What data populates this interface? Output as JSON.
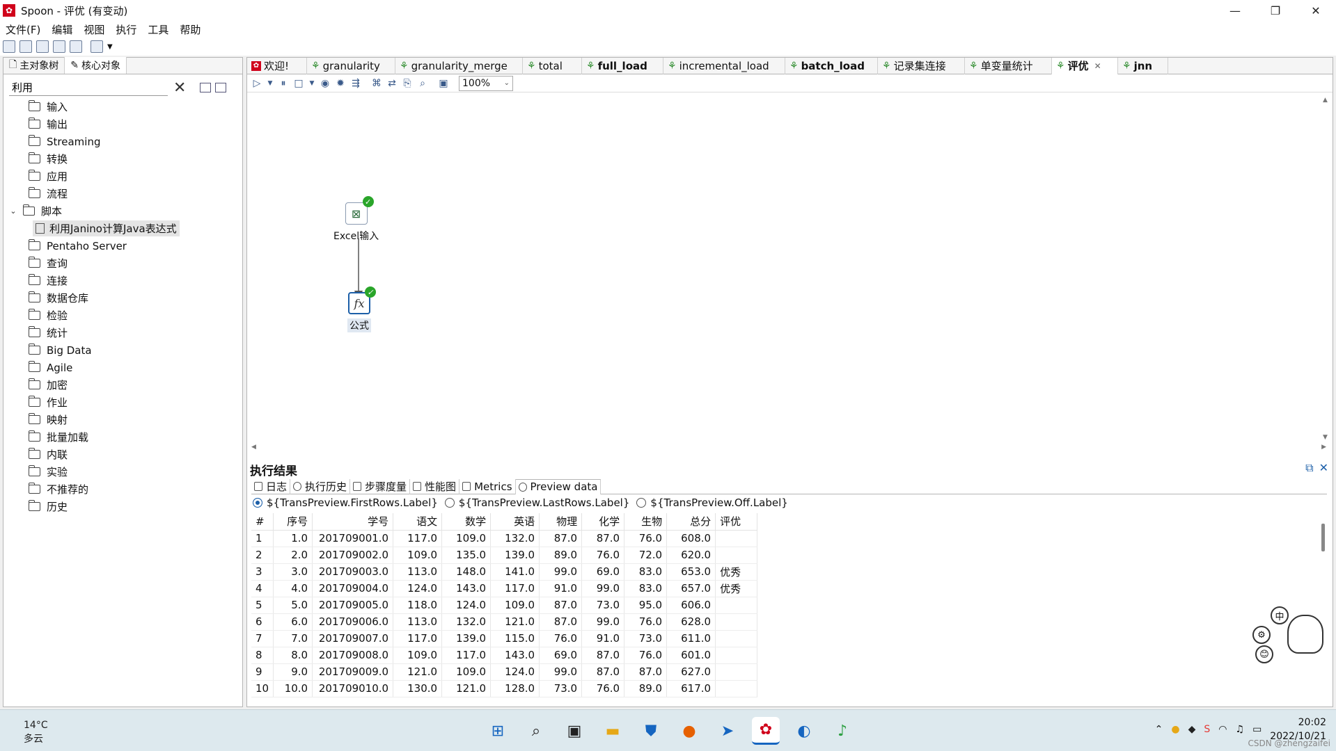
{
  "window": {
    "title": "Spoon - 评优 (有变动)",
    "app_icon": "spoon-icon",
    "controls": [
      "—",
      "❐",
      "✕"
    ]
  },
  "menu": [
    "文件(F)",
    "编辑",
    "视图",
    "执行",
    "工具",
    "帮助"
  ],
  "left_panel": {
    "tabs": [
      "主对象树",
      "核心对象"
    ],
    "search_value": "利用",
    "tree": [
      {
        "label": "输入",
        "expanded": false
      },
      {
        "label": "输出",
        "expanded": false
      },
      {
        "label": "Streaming",
        "expanded": false
      },
      {
        "label": "转换",
        "expanded": false
      },
      {
        "label": "应用",
        "expanded": false
      },
      {
        "label": "流程",
        "expanded": false
      },
      {
        "label": "脚本",
        "expanded": true
      },
      {
        "label": "利用Janino计算Java表达式",
        "child": true
      },
      {
        "label": "Pentaho Server"
      },
      {
        "label": "查询"
      },
      {
        "label": "连接"
      },
      {
        "label": "数据仓库"
      },
      {
        "label": "检验"
      },
      {
        "label": "统计"
      },
      {
        "label": "Big Data"
      },
      {
        "label": "Agile"
      },
      {
        "label": "加密"
      },
      {
        "label": "作业"
      },
      {
        "label": "映射"
      },
      {
        "label": "批量加载"
      },
      {
        "label": "内联"
      },
      {
        "label": "实验"
      },
      {
        "label": "不推荐的"
      },
      {
        "label": "历史"
      }
    ]
  },
  "editor_tabs": [
    {
      "label": "欢迎!",
      "icon": "welcome-icon",
      "bold": false
    },
    {
      "label": "granularity",
      "icon": "transformation-icon",
      "bold": false
    },
    {
      "label": "granularity_merge",
      "icon": "transformation-icon",
      "bold": false
    },
    {
      "label": "total",
      "icon": "transformation-icon",
      "bold": false
    },
    {
      "label": "full_load",
      "icon": "transformation-icon",
      "bold": true
    },
    {
      "label": "incremental_load",
      "icon": "transformation-icon",
      "bold": false
    },
    {
      "label": "batch_load",
      "icon": "transformation-icon",
      "bold": true
    },
    {
      "label": "记录集连接",
      "icon": "transformation-icon",
      "bold": false
    },
    {
      "label": "单变量统计",
      "icon": "transformation-icon",
      "bold": false
    },
    {
      "label": "评优",
      "icon": "transformation-icon",
      "bold": true,
      "active": true
    },
    {
      "label": "jnn",
      "icon": "transformation-icon",
      "bold": true
    }
  ],
  "zoom": "100%",
  "steps": {
    "excel": {
      "label": "Excel输入",
      "icon": "excel-icon"
    },
    "formula": {
      "label": "公式",
      "icon": "formula-icon",
      "glyph": "fx"
    }
  },
  "results": {
    "title": "执行结果",
    "tabs": [
      "日志",
      "执行历史",
      "步骤度量",
      "性能图",
      "Metrics",
      "Preview data"
    ],
    "radios": [
      "${TransPreview.FirstRows.Label}",
      "${TransPreview.LastRows.Label}",
      "${TransPreview.Off.Label}"
    ],
    "columns": [
      "#",
      "序号",
      "学号",
      "语文",
      "数学",
      "英语",
      "物理",
      "化学",
      "生物",
      "总分",
      "评优"
    ],
    "rows": [
      [
        "1",
        "1.0",
        "201709001.0",
        "117.0",
        "109.0",
        "132.0",
        "87.0",
        "87.0",
        "76.0",
        "608.0",
        ""
      ],
      [
        "2",
        "2.0",
        "201709002.0",
        "109.0",
        "135.0",
        "139.0",
        "89.0",
        "76.0",
        "72.0",
        "620.0",
        ""
      ],
      [
        "3",
        "3.0",
        "201709003.0",
        "113.0",
        "148.0",
        "141.0",
        "99.0",
        "69.0",
        "83.0",
        "653.0",
        "优秀"
      ],
      [
        "4",
        "4.0",
        "201709004.0",
        "124.0",
        "143.0",
        "117.0",
        "91.0",
        "99.0",
        "83.0",
        "657.0",
        "优秀"
      ],
      [
        "5",
        "5.0",
        "201709005.0",
        "118.0",
        "124.0",
        "109.0",
        "87.0",
        "73.0",
        "95.0",
        "606.0",
        ""
      ],
      [
        "6",
        "6.0",
        "201709006.0",
        "113.0",
        "132.0",
        "121.0",
        "87.0",
        "99.0",
        "76.0",
        "628.0",
        ""
      ],
      [
        "7",
        "7.0",
        "201709007.0",
        "117.0",
        "139.0",
        "115.0",
        "76.0",
        "91.0",
        "73.0",
        "611.0",
        ""
      ],
      [
        "8",
        "8.0",
        "201709008.0",
        "109.0",
        "117.0",
        "143.0",
        "69.0",
        "87.0",
        "76.0",
        "601.0",
        ""
      ],
      [
        "9",
        "9.0",
        "201709009.0",
        "121.0",
        "109.0",
        "124.0",
        "99.0",
        "87.0",
        "87.0",
        "627.0",
        ""
      ],
      [
        "10",
        "10.0",
        "201709010.0",
        "130.0",
        "121.0",
        "128.0",
        "73.0",
        "76.0",
        "89.0",
        "617.0",
        ""
      ]
    ]
  },
  "ime": [
    "中",
    "⚙",
    "😊"
  ],
  "taskbar": {
    "weather_temp": "14°C",
    "weather_desc": "多云",
    "apps": [
      "windows-start-icon",
      "search-icon",
      "task-view-icon",
      "file-explorer-icon",
      "defender-icon",
      "firefox-icon",
      "app-arrow-icon",
      "spoon-icon",
      "browser-icon",
      "music-icon"
    ],
    "time": "20:02",
    "date": "2022/10/21",
    "watermark": "CSDN @zhengzaifei"
  }
}
